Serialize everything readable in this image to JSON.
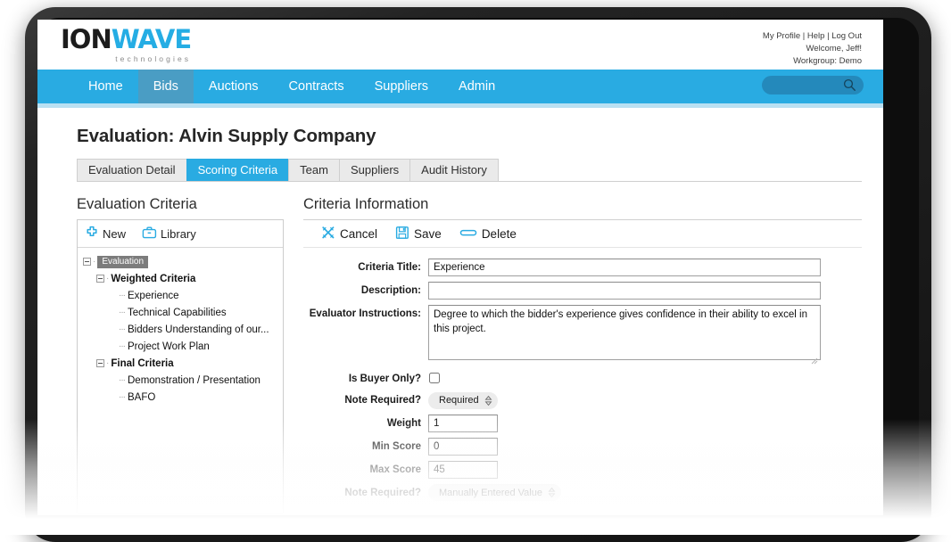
{
  "brand": {
    "logo_primary": "ION",
    "logo_accent": "WAVE",
    "logo_sub": "technologies",
    "accent_color": "#29abe2",
    "dark_color": "#1c1c1c"
  },
  "user_bar": {
    "my_profile": "My Profile",
    "sep1": "|",
    "help": "Help",
    "sep2": "|",
    "log_out": "Log Out",
    "welcome": "Welcome, Jeff!",
    "workgroup": "Workgroup: Demo"
  },
  "nav": {
    "items": [
      {
        "label": "Home",
        "active": false
      },
      {
        "label": "Bids",
        "active": true
      },
      {
        "label": "Auctions",
        "active": false
      },
      {
        "label": "Contracts",
        "active": false
      },
      {
        "label": "Suppliers",
        "active": false
      },
      {
        "label": "Admin",
        "active": false
      }
    ],
    "search_placeholder": "",
    "search_value": "",
    "search_icon": "search-icon"
  },
  "page": {
    "title": "Evaluation: Alvin Supply Company"
  },
  "tabs": [
    {
      "label": "Evaluation Detail",
      "active": false
    },
    {
      "label": "Scoring Criteria",
      "active": true
    },
    {
      "label": "Team",
      "active": false
    },
    {
      "label": "Suppliers",
      "active": false
    },
    {
      "label": "Audit History",
      "active": false
    }
  ],
  "left_panel": {
    "title": "Evaluation Criteria",
    "toolbar": {
      "new_label": "New",
      "new_icon": "plus-icon",
      "library_label": "Library",
      "library_icon": "briefcase-icon"
    },
    "tree": [
      {
        "label": "Evaluation",
        "level": 1,
        "selected": true,
        "expandable": true,
        "bold": false
      },
      {
        "label": "Weighted Criteria",
        "level": 2,
        "selected": false,
        "expandable": true,
        "bold": true
      },
      {
        "label": "Experience",
        "level": 3,
        "selected": false,
        "expandable": false,
        "bold": false
      },
      {
        "label": "Technical Capabilities",
        "level": 3,
        "selected": false,
        "expandable": false,
        "bold": false
      },
      {
        "label": "Bidders Understanding of our...",
        "level": 3,
        "selected": false,
        "expandable": false,
        "bold": false
      },
      {
        "label": "Project Work Plan",
        "level": 3,
        "selected": false,
        "expandable": false,
        "bold": false
      },
      {
        "label": "Final Criteria",
        "level": 2,
        "selected": false,
        "expandable": true,
        "bold": true
      },
      {
        "label": "Demonstration / Presentation",
        "level": 3,
        "selected": false,
        "expandable": false,
        "bold": false
      },
      {
        "label": "BAFO",
        "level": 3,
        "selected": false,
        "expandable": false,
        "bold": false
      }
    ]
  },
  "right_panel": {
    "title": "Criteria Information",
    "toolbar": {
      "cancel_label": "Cancel",
      "cancel_icon": "cancel-x-icon",
      "save_label": "Save",
      "save_icon": "floppy-disk-icon",
      "delete_label": "Delete",
      "delete_icon": "delete-minus-icon"
    },
    "fields": {
      "criteria_title_label": "Criteria Title:",
      "criteria_title_value": "Experience",
      "description_label": "Description:",
      "description_value": "",
      "evaluator_instructions_label": "Evaluator Instructions:",
      "evaluator_instructions_value": "Degree to which the bidder's experience gives confidence in their ability to excel in this project.",
      "is_buyer_only_label": "Is Buyer Only?",
      "is_buyer_only_checked": false,
      "note_required_label": "Note Required?",
      "note_required_value": "Required",
      "weight_label": "Weight",
      "weight_value": "1",
      "min_score_label": "Min Score",
      "min_score_value": "0",
      "max_score_label": "Max Score",
      "max_score_value": "45",
      "score_type_label": "Note Required?",
      "score_type_value": "Manually Entered Value"
    }
  }
}
